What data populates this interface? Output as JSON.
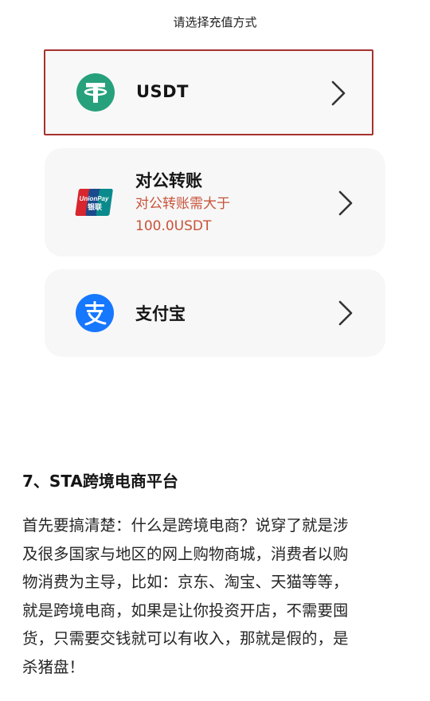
{
  "header": {
    "title": "请选择充值方式"
  },
  "payment_methods": [
    {
      "id": "usdt",
      "label": "USDT",
      "icon": "tether-icon",
      "selected": true
    },
    {
      "id": "bank",
      "label": "对公转账",
      "note_lines": [
        "对公转账需大于",
        "100.0USDT"
      ],
      "icon": "unionpay-icon",
      "selected": false
    },
    {
      "id": "alipay",
      "label": "支付宝",
      "icon": "alipay-icon",
      "selected": false
    }
  ],
  "colors": {
    "selected_border": "#a5322f",
    "note_text": "#c8533a",
    "tether_green": "#26a17b",
    "alipay_blue": "#1677ff"
  },
  "article": {
    "heading": "7、STA跨境电商平台",
    "lines": [
      "首先要搞清楚：什么是跨境电商？说穿了就是涉",
      "及很多国家与地区的网上购物商城，消费者以购",
      "物消费为主导，比如：京东、淘宝、天猫等等，",
      "就是跨境电商，如果是让你投资开店，不需要囤",
      "货，只需要交钱就可以有收入，那就是假的，是",
      "杀猪盘！"
    ]
  }
}
